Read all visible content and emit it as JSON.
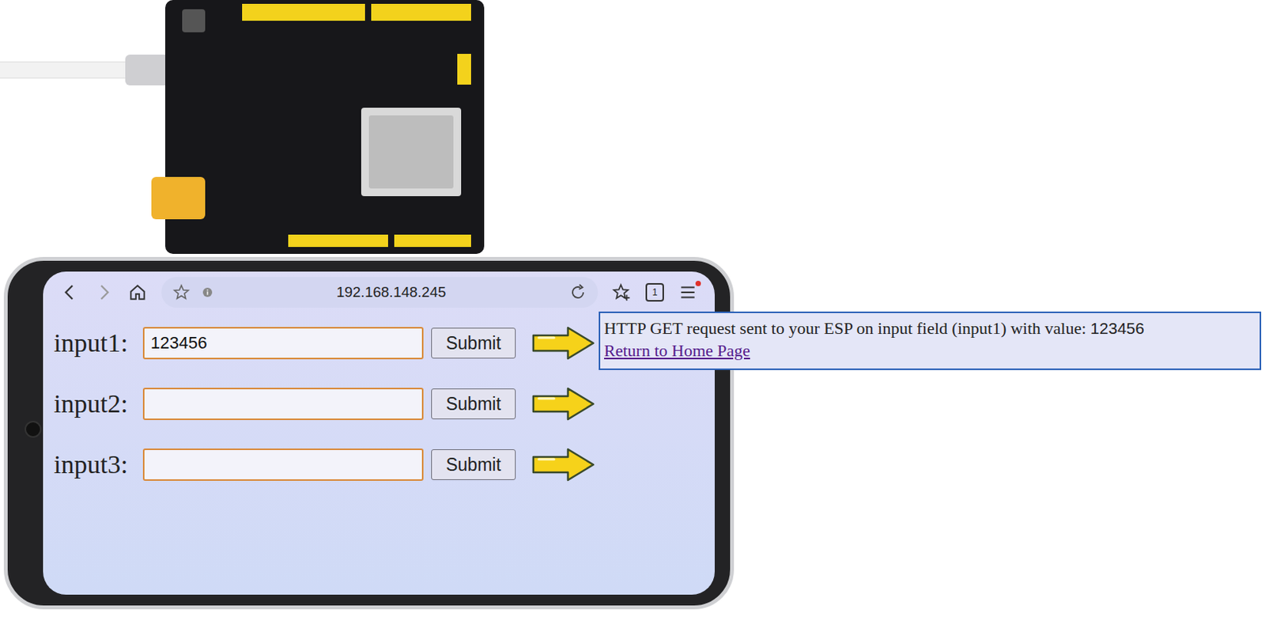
{
  "browser": {
    "url": "192.168.148.245",
    "tab_count": "1",
    "menu_notification": true
  },
  "form": {
    "fields": [
      {
        "label": "input1:",
        "value": "123456",
        "button": "Submit"
      },
      {
        "label": "input2:",
        "value": "",
        "button": "Submit"
      },
      {
        "label": "input3:",
        "value": "",
        "button": "Submit"
      }
    ]
  },
  "callout": {
    "message": "HTTP GET request sent to your ESP on input field (input1) with value:",
    "value": "123456",
    "link": "Return to Home Page"
  }
}
